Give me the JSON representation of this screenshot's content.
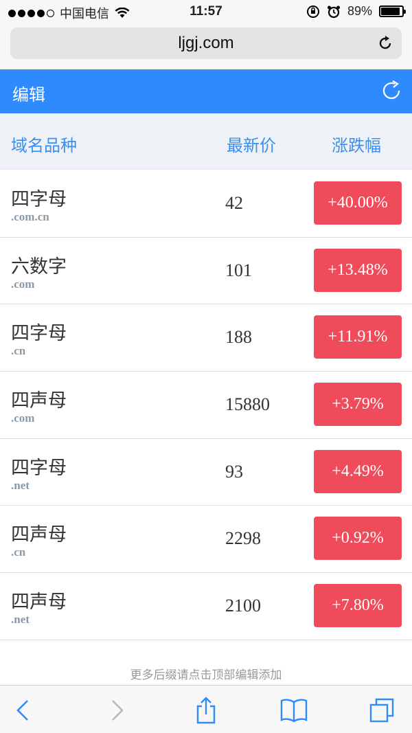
{
  "status_bar": {
    "carrier": "中国电信",
    "time": "11:57",
    "battery_text": "89%",
    "battery_level": 0.89
  },
  "browser": {
    "url": "ljgj.com"
  },
  "header": {
    "edit_label": "编辑"
  },
  "table": {
    "columns": [
      "域名品种",
      "最新价",
      "涨跌幅"
    ],
    "rows": [
      {
        "name": "四字母",
        "suffix": ".com.cn",
        "price": "42",
        "change": "+40.00%"
      },
      {
        "name": "六数字",
        "suffix": ".com",
        "price": "101",
        "change": "+13.48%"
      },
      {
        "name": "四字母",
        "suffix": ".cn",
        "price": "188",
        "change": "+11.91%"
      },
      {
        "name": "四声母",
        "suffix": ".com",
        "price": "15880",
        "change": "+3.79%"
      },
      {
        "name": "四字母",
        "suffix": ".net",
        "price": "93",
        "change": "+4.49%"
      },
      {
        "name": "四声母",
        "suffix": ".cn",
        "price": "2298",
        "change": "+0.92%"
      },
      {
        "name": "四声母",
        "suffix": ".net",
        "price": "2100",
        "change": "+7.80%"
      }
    ]
  },
  "footnote": "更多后缀请点击顶部编辑添加",
  "colors": {
    "accent": "#2f8bfd",
    "up": "#f04b5a",
    "column_header_text": "#3a8ef0"
  },
  "toolbar_icons": [
    "back-icon",
    "forward-icon",
    "share-icon",
    "bookmarks-icon",
    "tabs-icon"
  ]
}
